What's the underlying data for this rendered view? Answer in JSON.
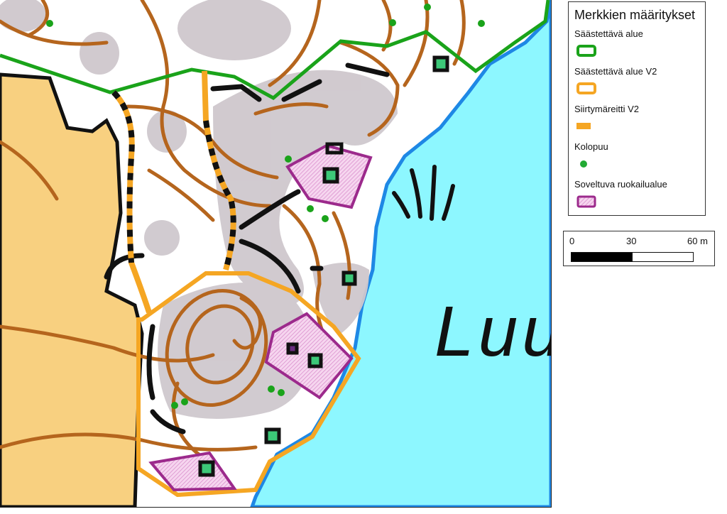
{
  "map": {
    "water_label": "Luu"
  },
  "legend": {
    "title": "Merkkien määritykset",
    "items": [
      {
        "label": "Säästettävä alue",
        "symbol": "outline",
        "color": "#1aa31a"
      },
      {
        "label": "Säästettävä alue V2",
        "symbol": "outline",
        "color": "#f5a623"
      },
      {
        "label": "Siirtymäreitti V2",
        "symbol": "line",
        "color": "#f5a623"
      },
      {
        "label": "Kolopuu",
        "symbol": "point",
        "color": "#22aa33"
      },
      {
        "label": "Soveltuva ruokailualue",
        "symbol": "polygon",
        "color": "#9c2a8c"
      }
    ]
  },
  "scalebar": {
    "labels": [
      "0",
      "30",
      "60 m"
    ]
  },
  "colors": {
    "water": "#8df7ff",
    "shore": "#1e88e5",
    "field": "#f8d080",
    "rock": "#cfc8cd",
    "contour": "#b5651d",
    "green_area": "#1aa31a",
    "orange_area": "#f5a623",
    "feeding_area": "#9c2a8c"
  }
}
